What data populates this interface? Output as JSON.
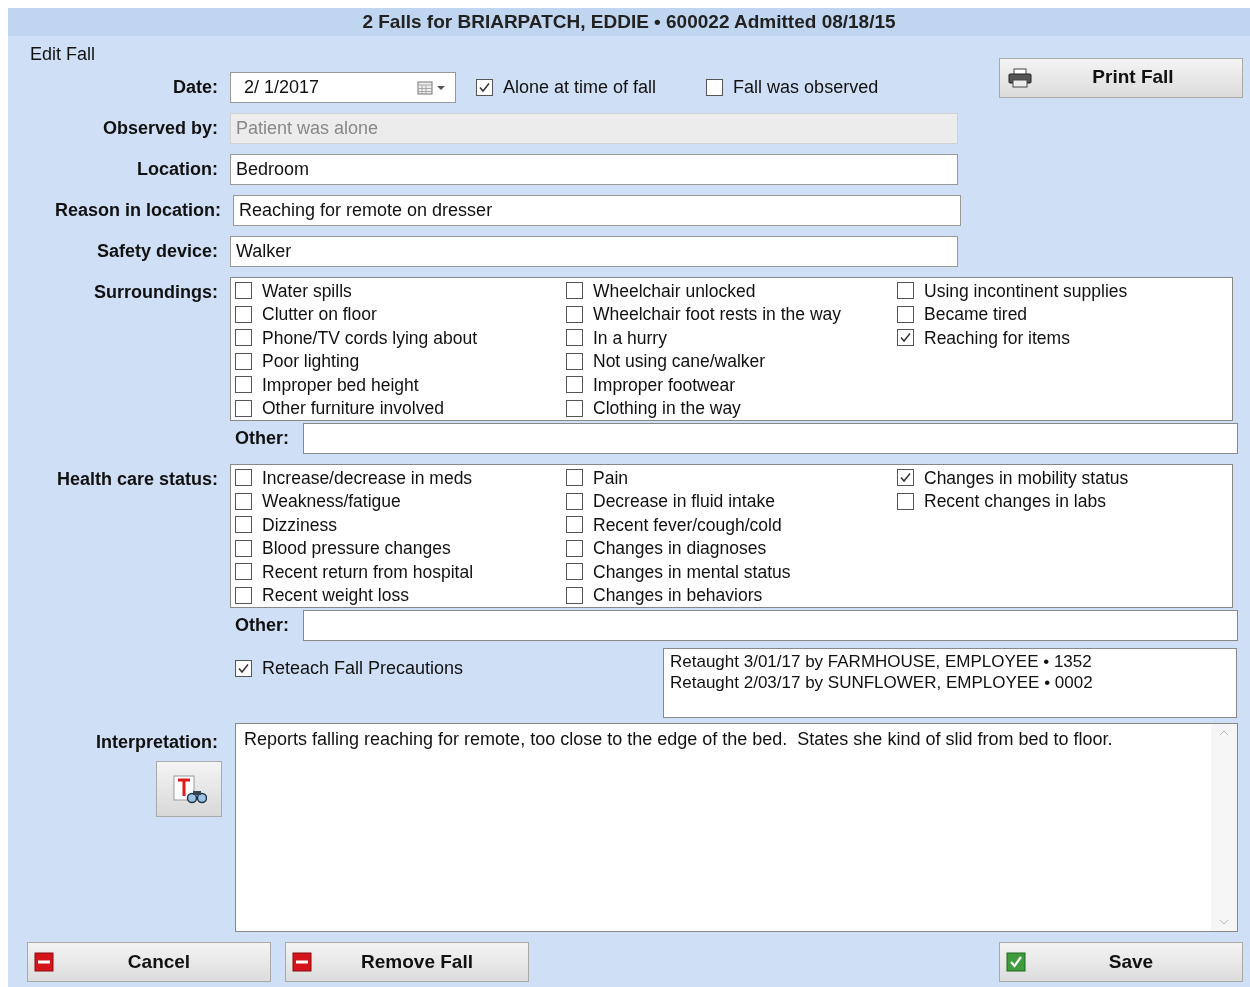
{
  "window": {
    "title": "2 Falls for BRIARPATCH, EDDIE • 600022  Admitted 08/18/15"
  },
  "section_title": "Edit Fall",
  "date": {
    "label": "Date:",
    "value": "2/ 1/2017"
  },
  "top_checks": [
    {
      "label": "Alone at time of fall",
      "checked": true
    },
    {
      "label": "Fall was observed",
      "checked": false
    }
  ],
  "print_button": "Print Fall",
  "text_fields": [
    {
      "label": "Observed by:",
      "value": "Patient was alone",
      "disabled": true
    },
    {
      "label": "Location:",
      "value": "Bedroom",
      "disabled": false
    },
    {
      "label": "Reason in location:",
      "value": "Reaching for remote on dresser",
      "disabled": false
    },
    {
      "label": "Safety device:",
      "value": "Walker",
      "disabled": false
    }
  ],
  "groups": [
    {
      "label": "Surroundings:",
      "other_label": "Other:",
      "columns": [
        [
          {
            "label": "Water spills",
            "checked": false
          },
          {
            "label": "Clutter on floor",
            "checked": false
          },
          {
            "label": "Phone/TV cords lying about",
            "checked": false
          },
          {
            "label": "Poor lighting",
            "checked": false
          },
          {
            "label": "Improper bed height",
            "checked": false
          },
          {
            "label": "Other furniture involved",
            "checked": false
          }
        ],
        [
          {
            "label": "Wheelchair unlocked",
            "checked": false
          },
          {
            "label": "Wheelchair foot rests in the way",
            "checked": false
          },
          {
            "label": "In a hurry",
            "checked": false
          },
          {
            "label": "Not using cane/walker",
            "checked": false
          },
          {
            "label": "Improper footwear",
            "checked": false
          },
          {
            "label": "Clothing in the way",
            "checked": false
          }
        ],
        [
          {
            "label": "Using incontinent supplies",
            "checked": false
          },
          {
            "label": "Became tired",
            "checked": false
          },
          {
            "label": "Reaching for items",
            "checked": true
          }
        ]
      ]
    },
    {
      "label": "Health care status:",
      "other_label": "Other:",
      "columns": [
        [
          {
            "label": "Increase/decrease in meds",
            "checked": false
          },
          {
            "label": "Weakness/fatigue",
            "checked": false
          },
          {
            "label": "Dizziness",
            "checked": false
          },
          {
            "label": "Blood pressure changes",
            "checked": false
          },
          {
            "label": "Recent return from hospital",
            "checked": false
          },
          {
            "label": "Recent weight loss",
            "checked": false
          }
        ],
        [
          {
            "label": "Pain",
            "checked": false
          },
          {
            "label": "Decrease in fluid intake",
            "checked": false
          },
          {
            "label": "Recent fever/cough/cold",
            "checked": false
          },
          {
            "label": "Changes in diagnoses",
            "checked": false
          },
          {
            "label": "Changes in mental status",
            "checked": false
          },
          {
            "label": "Changes in behaviors",
            "checked": false
          }
        ],
        [
          {
            "label": "Changes in mobility status",
            "checked": true
          },
          {
            "label": "Recent changes in labs",
            "checked": false
          }
        ]
      ]
    }
  ],
  "reteach": {
    "label": "Reteach Fall Precautions",
    "checked": true,
    "log": [
      "Retaught 3/01/17 by FARMHOUSE, EMPLOYEE • 1352",
      "Retaught 2/03/17 by SUNFLOWER, EMPLOYEE • 0002"
    ]
  },
  "interpretation": {
    "label": "Interpretation:",
    "value": "Reports falling reaching for remote, too close to the edge of the bed.  States she kind of slid from bed to floor."
  },
  "buttons": [
    {
      "label": "Cancel",
      "kind": "remove"
    },
    {
      "label": "Remove Fall",
      "kind": "remove"
    },
    {
      "label": "Save",
      "kind": "confirm"
    }
  ]
}
